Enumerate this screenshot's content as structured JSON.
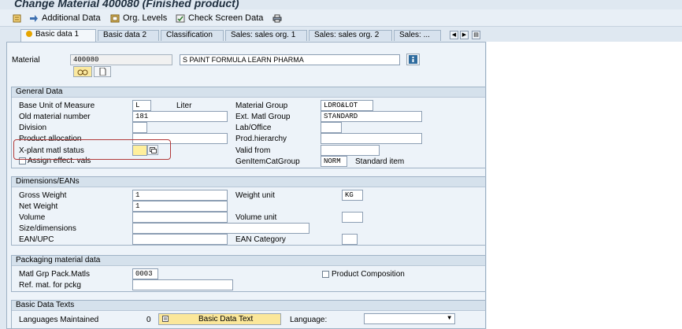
{
  "window": {
    "title": "Change Material 400080 (Finished product)"
  },
  "toolbar": {
    "additional_data": "Additional Data",
    "org_levels": "Org. Levels",
    "check_screen_data": "Check Screen Data"
  },
  "tabs": [
    {
      "label": "Basic data 1"
    },
    {
      "label": "Basic data 2"
    },
    {
      "label": "Classification"
    },
    {
      "label": "Sales: sales org. 1"
    },
    {
      "label": "Sales: sales org. 2"
    },
    {
      "label": "Sales: ..."
    }
  ],
  "material": {
    "label": "Material",
    "number": "400080",
    "description": "S PAINT FORMULA LEARN PHARMA"
  },
  "general_data": {
    "title": "General Data",
    "base_uom_label": "Base Unit of Measure",
    "base_uom_value": "L",
    "base_uom_text": "Liter",
    "old_material_label": "Old material number",
    "old_material_value": "181",
    "division_label": "Division",
    "division_value": "",
    "product_allocation_label": "Product allocation",
    "product_allocation_value": "",
    "xplant_status_label": "X-plant matl status",
    "xplant_status_value": "",
    "assign_effect_vals_label": "Assign effect. vals",
    "material_group_label": "Material Group",
    "material_group_value": "LDRO&LOT",
    "ext_matl_group_label": "Ext. Matl Group",
    "ext_matl_group_value": "STANDARD",
    "lab_office_label": "Lab/Office",
    "lab_office_value": "",
    "prod_hierarchy_label": "Prod.hierarchy",
    "prod_hierarchy_value": "",
    "valid_from_label": "Valid from",
    "valid_from_value": "",
    "gen_item_cat_label": "GenItemCatGroup",
    "gen_item_cat_value": "NORM",
    "gen_item_cat_text": "Standard item"
  },
  "dimensions": {
    "title": "Dimensions/EANs",
    "gross_weight_label": "Gross Weight",
    "gross_weight_value": "1",
    "net_weight_label": "Net Weight",
    "net_weight_value": "1",
    "volume_label": "Volume",
    "volume_value": "",
    "size_label": "Size/dimensions",
    "size_value": "",
    "ean_label": "EAN/UPC",
    "ean_value": "",
    "weight_unit_label": "Weight unit",
    "weight_unit_value": "KG",
    "volume_unit_label": "Volume unit",
    "volume_unit_value": "",
    "ean_category_label": "EAN Category",
    "ean_category_value": ""
  },
  "packaging": {
    "title": "Packaging material data",
    "matl_grp_label": "Matl Grp Pack.Matls",
    "matl_grp_value": "0003",
    "ref_mat_label": "Ref. mat. for pckg",
    "ref_mat_value": "",
    "product_composition_label": "Product Composition"
  },
  "basic_texts": {
    "title": "Basic Data Texts",
    "languages_label": "Languages Maintained",
    "languages_count": "0",
    "button_label": "Basic Data Text",
    "language_label": "Language:",
    "language_value": ""
  }
}
